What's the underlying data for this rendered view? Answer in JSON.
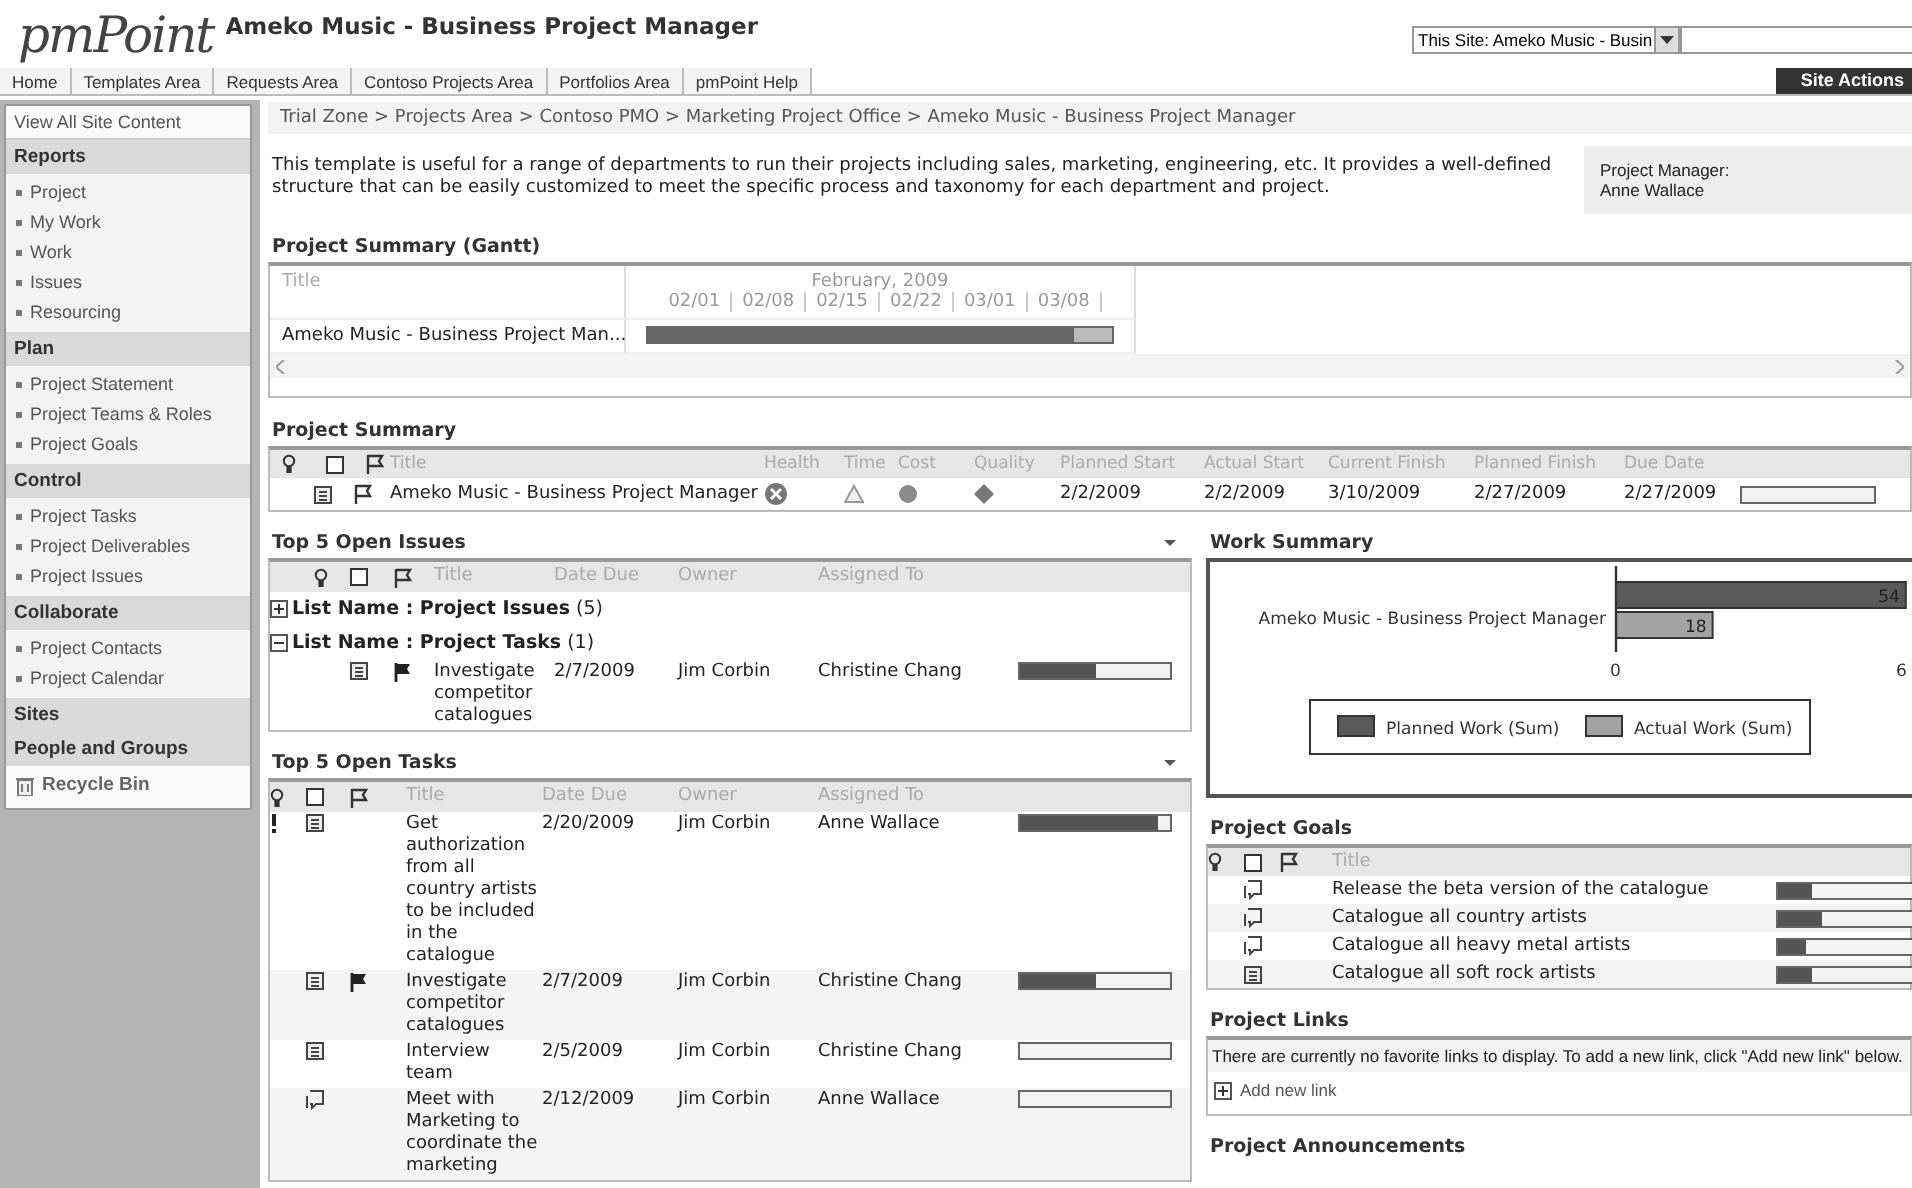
{
  "header": {
    "logo": "pmPoint",
    "title": "Ameko Music - Business Project Manager",
    "search_scope": "This Site: Ameko Music - Busin",
    "site_actions": "Site Actions"
  },
  "nav_tabs": [
    "Home",
    "Templates Area",
    "Requests Area",
    "Contoso Projects Area",
    "Portfolios Area",
    "pmPoint Help"
  ],
  "sidebar": {
    "top_link": "View All Site Content",
    "sections": [
      {
        "heading": "Reports",
        "items": [
          "Project",
          "My Work",
          "Work",
          "Issues",
          "Resourcing"
        ]
      },
      {
        "heading": "Plan",
        "items": [
          "Project Statement",
          "Project Teams & Roles",
          "Project Goals"
        ]
      },
      {
        "heading": "Control",
        "items": [
          "Project Tasks",
          "Project Deliverables",
          "Project Issues"
        ]
      },
      {
        "heading": "Collaborate",
        "items": [
          "Project Contacts",
          "Project Calendar"
        ]
      },
      {
        "heading": "Sites"
      },
      {
        "heading": "People and Groups"
      }
    ],
    "recycle_bin": "Recycle Bin"
  },
  "breadcrumb": "Trial Zone > Projects Area > Contoso PMO > Marketing Project Office > Ameko Music - Business Project Manager",
  "description": "This template is useful for a range of departments to run their projects including sales, marketing, engineering, etc. It provides a well-defined structure that can be easily customized to meet the specific process and taxonomy for each department and project.",
  "project_manager": {
    "label": "Project Manager:",
    "name": "Anne Wallace"
  },
  "gantt": {
    "heading": "Project Summary (Gantt)",
    "title_column": "Title",
    "month": "February, 2009",
    "weeks": [
      "02/01",
      "02/08",
      "02/15",
      "02/22",
      "03/01",
      "03/08"
    ],
    "rows": [
      {
        "title": "Ameko Music - Business Project Man...",
        "level": 0.92
      }
    ]
  },
  "project_summary": {
    "heading": "Project Summary",
    "columns": [
      "Title",
      "Health",
      "Time",
      "Cost",
      "Quality",
      "Planned Start",
      "Actual Start",
      "Current Finish",
      "Planned Finish",
      "Due Date"
    ],
    "rows": [
      {
        "kind": "task",
        "flagged": false,
        "title": "Ameko Music - Business Project Manager",
        "indicators": [
          {
            "kind": "cross"
          },
          {
            "kind": "triangle"
          },
          {
            "kind": "circle"
          },
          {
            "kind": "diamond"
          }
        ],
        "dates": [
          "2/2/2009",
          "2/2/2009",
          "3/10/2009",
          "2/27/2009",
          "2/27/2009"
        ],
        "level": 0
      }
    ]
  },
  "open_issues": {
    "heading": "Top 5 Open Issues",
    "columns": [
      "Title",
      "Date Due",
      "Owner",
      "Assigned To"
    ],
    "groups": [
      {
        "label": "**List Name : Project Issues** (5)",
        "expanded": false
      },
      {
        "label": "**List Name : Project Tasks** (1)",
        "expanded": true,
        "rows": [
          {
            "high_priority": false,
            "kind": "task",
            "flagged": true,
            "title": "Investigate competitor catalogues",
            "date_due": "2/7/2009",
            "owner": "Jim Corbin",
            "assigned_to": "Christine Chang",
            "level": 0.5
          }
        ]
      }
    ]
  },
  "open_tasks": {
    "heading": "Top 5 Open Tasks",
    "columns": [
      "Title",
      "Date Due",
      "Owner",
      "Assigned To"
    ],
    "rows": [
      {
        "high_priority": true,
        "kind": "task",
        "flagged": false,
        "title": "Get authorization from all country artists to be included in the catalogue",
        "date_due": "2/20/2009",
        "owner": "Jim Corbin",
        "assigned_to": "Anne Wallace",
        "level": 0.92
      },
      {
        "high_priority": false,
        "kind": "task",
        "flagged": true,
        "title": "Investigate competitor catalogues",
        "date_due": "2/7/2009",
        "owner": "Jim Corbin",
        "assigned_to": "Christine Chang",
        "level": 0.5
      },
      {
        "high_priority": false,
        "kind": "task",
        "flagged": false,
        "title": "Interview team",
        "date_due": "2/5/2009",
        "owner": "Jim Corbin",
        "assigned_to": "Christine Chang",
        "level": 0
      },
      {
        "high_priority": false,
        "kind": "milestone",
        "flagged": false,
        "title": "Meet with Marketing to coordinate the marketing",
        "date_due": "2/12/2009",
        "owner": "Jim Corbin",
        "assigned_to": "Anne Wallace",
        "level": 0
      }
    ]
  },
  "work_summary": {
    "heading": "Work Summary",
    "chart_data": {
      "type": "bar",
      "orientation": "horizontal",
      "categories": [
        "Ameko Music - Business Project Manager"
      ],
      "series": [
        {
          "name": "Planned Work (Sum)",
          "color": "#5a5a5a",
          "values": [
            54
          ]
        },
        {
          "name": "Actual Work (Sum)",
          "color": "#a3a3a3",
          "values": [
            18
          ]
        }
      ],
      "data_labels": true,
      "legend": "bottom",
      "annotations": [
        {
          "text": "0"
        },
        {
          "text": "6"
        }
      ]
    }
  },
  "project_goals": {
    "heading": "Project Goals",
    "columns": [
      "Title"
    ],
    "rows": [
      {
        "kind": "milestone",
        "title": "Release the beta version of the catalogue",
        "level": 0.25
      },
      {
        "kind": "milestone",
        "title": "Catalogue all country artists",
        "level": 0.33
      },
      {
        "kind": "milestone",
        "title": "Catalogue all heavy metal artists",
        "level": 0.2
      },
      {
        "kind": "task",
        "title": "Catalogue all soft rock artists",
        "level": 0.25
      }
    ]
  },
  "project_links": {
    "heading": "Project Links",
    "message": "There are currently no favorite links to display. To add a new link, click \"Add new link\" below.",
    "add_link": "Add new link"
  },
  "project_announcements": {
    "heading": "Project Announcements"
  }
}
